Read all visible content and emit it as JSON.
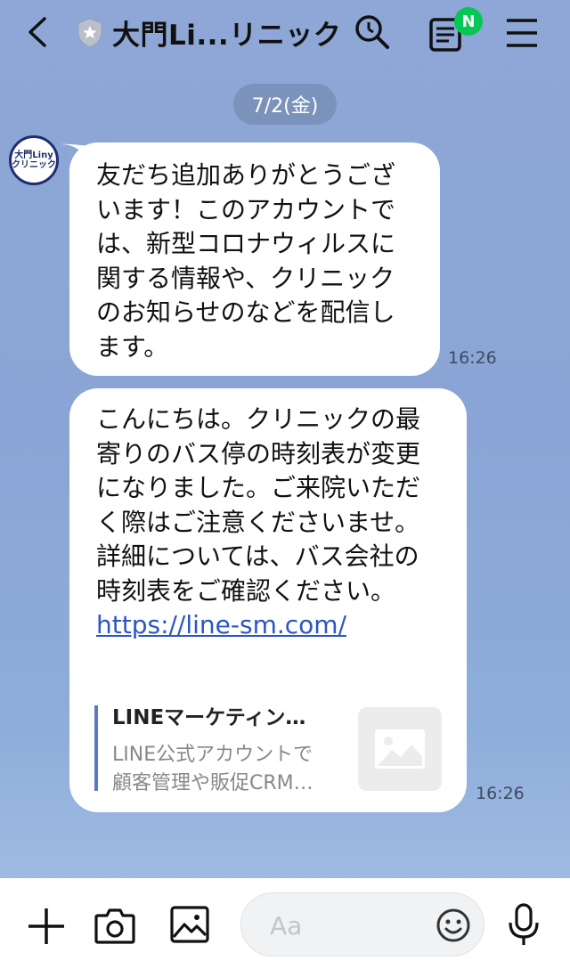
{
  "header": {
    "title": "大門Li...リニック",
    "notification_badge": "N",
    "icons": [
      "back-chevron-icon",
      "shield-star-icon",
      "search-icon",
      "notes-icon",
      "menu-icon"
    ]
  },
  "chat": {
    "date_label": "7/2(金)",
    "avatar": {
      "line1": "大門Liny",
      "line2": "クリニック"
    },
    "messages": [
      {
        "lines": [
          "友だち追加ありがとうござ",
          "います！このアカウントで",
          "は、新型コロナウィルスに",
          "関する情報や、クリニック",
          "のお知らせのなどを配信し",
          "ます。"
        ],
        "time": "16:26"
      },
      {
        "lines": [
          "こんにちは。クリニックの最",
          "寄りのバス停の時刻表が変更",
          "になりました。ご来院いただ",
          "く際はご注意くださいませ。",
          "詳細については、バス会社の",
          "時刻表をご確認ください。"
        ],
        "link": "https://line-sm.com/",
        "preview": {
          "title": "LINEマーケティン…",
          "desc_line1": "LINE公式アカウントで",
          "desc_line2": "顧客管理や販促CRM…"
        },
        "time": "16:26"
      }
    ]
  },
  "input": {
    "placeholder": "Aa",
    "icons": [
      "plus-icon",
      "camera-icon",
      "image-icon",
      "emoji-icon",
      "microphone-icon"
    ]
  },
  "colors": {
    "accent_green": "#06c755",
    "link_blue": "#2a56c6",
    "chat_background": "#8ea7d6"
  }
}
